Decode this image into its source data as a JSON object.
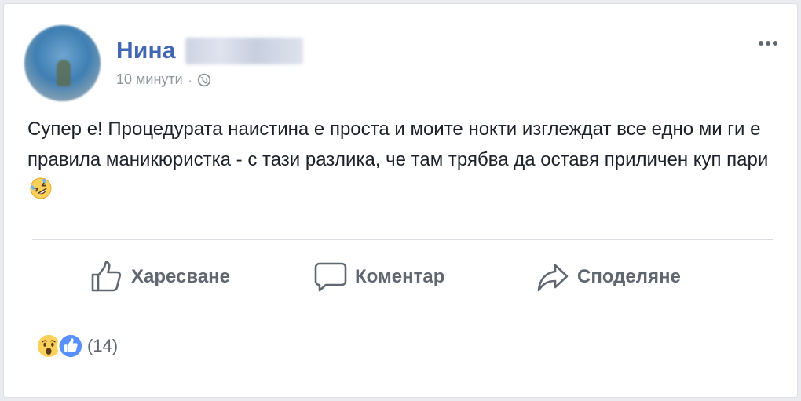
{
  "author": {
    "first_name": "Нина"
  },
  "meta": {
    "time": "10 минути",
    "separator": "·",
    "privacy_icon": "globe-icon"
  },
  "post": {
    "text": "Супер е! Процедурата наистина е проста и моите нокти изглеждат все едно ми ги е правила маникюристка - с тази разлика, че там трябва да оставя приличен куп пари",
    "trailing_emoji": "rolling-on-floor-laughing-emoji"
  },
  "actions": {
    "like_label": "Харесване",
    "comment_label": "Коментар",
    "share_label": "Споделяне"
  },
  "reactions": {
    "types": [
      "wow-reaction-icon",
      "like-reaction-icon"
    ],
    "count_label": "(14)"
  },
  "colors": {
    "name": "#4267b2",
    "meta": "#90949c",
    "action": "#606770",
    "like_blue": "#5890ff",
    "emoji_yellow": "#fbd05b"
  }
}
